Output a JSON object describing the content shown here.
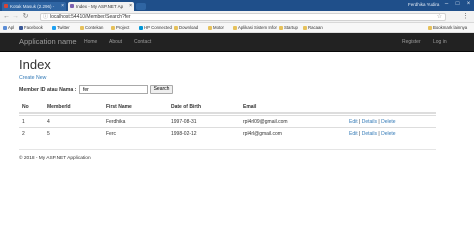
{
  "browser": {
    "tabs": [
      {
        "title": "Kotak Masuk (2.296) - ",
        "active": false
      },
      {
        "title": "Index - My ASP.NET Ap",
        "active": true
      }
    ],
    "user": "Ferdhika Yudira",
    "url": "localhost:54410/Member/Search?fer",
    "bookmarks": [
      {
        "label": "Apl",
        "icon": "apps-icon"
      },
      {
        "label": "Facebook",
        "icon": "facebook-icon"
      },
      {
        "label": "Twitter",
        "icon": "twitter-icon"
      },
      {
        "label": "Contekan",
        "icon": "folder-icon"
      },
      {
        "label": "Project",
        "icon": "folder-icon"
      },
      {
        "label": "HP Connected",
        "icon": "hp-icon"
      },
      {
        "label": "Download",
        "icon": "folder-icon"
      },
      {
        "label": "Motor",
        "icon": "folder-icon"
      },
      {
        "label": "Aplikasi Sistem Infor",
        "icon": "folder-icon"
      },
      {
        "label": "Startup",
        "icon": "folder-icon"
      },
      {
        "label": "Racaan",
        "icon": "folder-icon"
      },
      {
        "label": "Bookmark lainnya",
        "icon": "folder-icon"
      }
    ]
  },
  "navbar": {
    "brand": "Application name",
    "links": [
      "Home",
      "About",
      "Contact"
    ],
    "right_links": [
      "Register",
      "Log in"
    ]
  },
  "page": {
    "title": "Index",
    "create_link": "Create New",
    "search_label": "Member ID atau Nama :",
    "search_value": "fer",
    "search_button": "Search"
  },
  "table": {
    "columns": [
      "No",
      "MemberId",
      "First Name",
      "Date of Birth",
      "Email",
      ""
    ],
    "rows": [
      {
        "no": "1",
        "member_id": "4",
        "first_name": "Ferdhika",
        "dob": "1997-08-31",
        "email": "rpl4rl09@gmail.com"
      },
      {
        "no": "2",
        "member_id": "5",
        "first_name": "Ferc",
        "dob": "1998-02-12",
        "email": "rpl4rl@gmail.com"
      }
    ],
    "actions": {
      "edit": "Edit",
      "details": "Details",
      "delete": "Delete",
      "separator": "|"
    }
  },
  "footer": {
    "text": "© 2018 - My ASP.NET Application"
  },
  "colors": {
    "navbar_bg": "#222222",
    "link": "#337ab7",
    "tabstrip": "#1f4f8a"
  }
}
